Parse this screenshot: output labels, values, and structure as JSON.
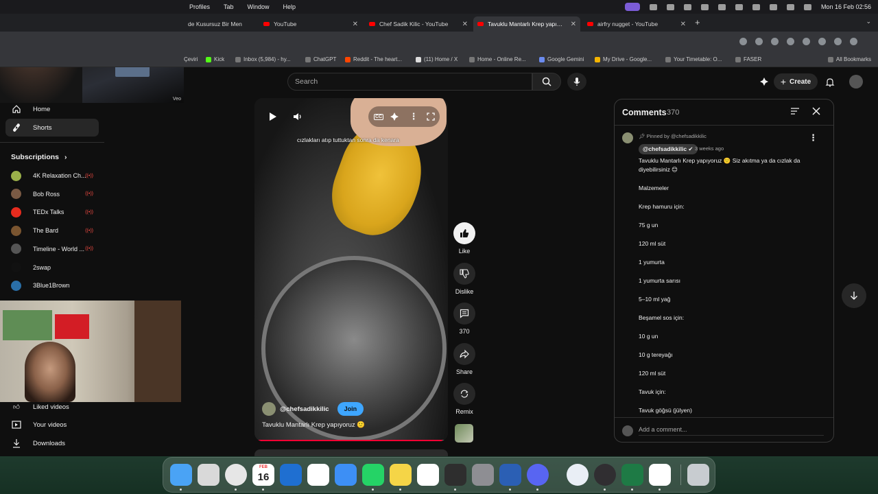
{
  "menubar": {
    "menus": [
      "Profiles",
      "Tab",
      "Window",
      "Help"
    ],
    "datetime": "Mon 16 Feb  02:56"
  },
  "tabs": [
    {
      "label": "de Kusursuz Bir Men"
    },
    {
      "label": "YouTube"
    },
    {
      "label": "Chef Sadik Kilic - YouTube"
    },
    {
      "label": "Tavuklu Mantarlı Krep yapıyoru"
    },
    {
      "label": "airfry nugget - YouTube"
    }
  ],
  "bookmarks": [
    "Çeviri",
    "Kick",
    "Inbox (5,984) - hy...",
    "ChatGPT",
    "Reddit - The heart...",
    "(11) Home / X",
    "Home - Online Re...",
    "Google Gemini",
    "My Drive - Google...",
    "Your Timetable: O...",
    "FASER",
    "All Bookmarks"
  ],
  "header": {
    "search_placeholder": "Search",
    "create_label": "Create"
  },
  "sidebar": {
    "home": "Home",
    "shorts": "Shorts",
    "subscriptions_title": "Subscriptions",
    "subscriptions": [
      {
        "name": "4K Relaxation Ch...",
        "live": true,
        "color": "#9bb04a"
      },
      {
        "name": "Bob Ross",
        "live": true,
        "color": "#7a5a44"
      },
      {
        "name": "TEDx Talks",
        "live": true,
        "color": "#e62b1e"
      },
      {
        "name": "The Bard",
        "live": true,
        "color": "#7a5530"
      },
      {
        "name": "Timeline - World ...",
        "live": true,
        "color": "#555555"
      },
      {
        "name": "2swap",
        "live": false,
        "color": "#111111"
      },
      {
        "name": "3Blue1Brown",
        "live": false,
        "color": "#2a6fa8"
      }
    ],
    "liked": "Liked videos",
    "your_videos": "Your videos",
    "downloads": "Downloads"
  },
  "webcam": {
    "tag": "Veo"
  },
  "short": {
    "caption": "cızlakları atıp tuttuktan sonra da kenara",
    "channel": "@chefsadikkilic",
    "join": "Join",
    "title": "Tavuklu Mantarlı Krep yapıyoruz 🙂",
    "cc_label": "CC",
    "progress": 0.97
  },
  "actions": {
    "like": "Like",
    "dislike": "Dislike",
    "comments": "370",
    "share": "Share",
    "remix": "Remix"
  },
  "comments": {
    "title": "Comments",
    "count": "370",
    "pinned": "Pinned by @chefsadikkilic",
    "author": "@chefsadikkilic",
    "ago": "3 weeks ago",
    "lines": [
      "Tavuklu Mantarlı Krep yapıyoruz 🙂 Siz akıtma ya da cızlak da diyebilirsiniz 😊",
      "Malzemeler",
      "Krep hamuru için:",
      "75 g un",
      "120 ml süt",
      "1 yumurta",
      "1 yumurta sarısı",
      "5–10 ml yağ",
      "Beşamel sos için:",
      "10 g un",
      "10 g tereyağı",
      "120 ml süt",
      "Tavuk için:",
      "Tavuk göğsü (jülyen)"
    ],
    "add_placeholder": "Add a comment..."
  },
  "dock": {
    "calendar_month": "FEB",
    "calendar_day": "16",
    "apps": [
      "finder-icon",
      "launchpad-icon",
      "chrome-icon",
      "calendar-icon",
      "outlook-icon",
      "gmail-icon",
      "mail-icon",
      "whatsapp-icon",
      "notes-icon",
      "reminders-icon",
      "numbers-icon",
      "settings-icon",
      "word-icon",
      "discord-icon",
      "quicktime-icon",
      "obs-icon",
      "excel-icon",
      "gemini-icon",
      "trash-icon"
    ]
  }
}
